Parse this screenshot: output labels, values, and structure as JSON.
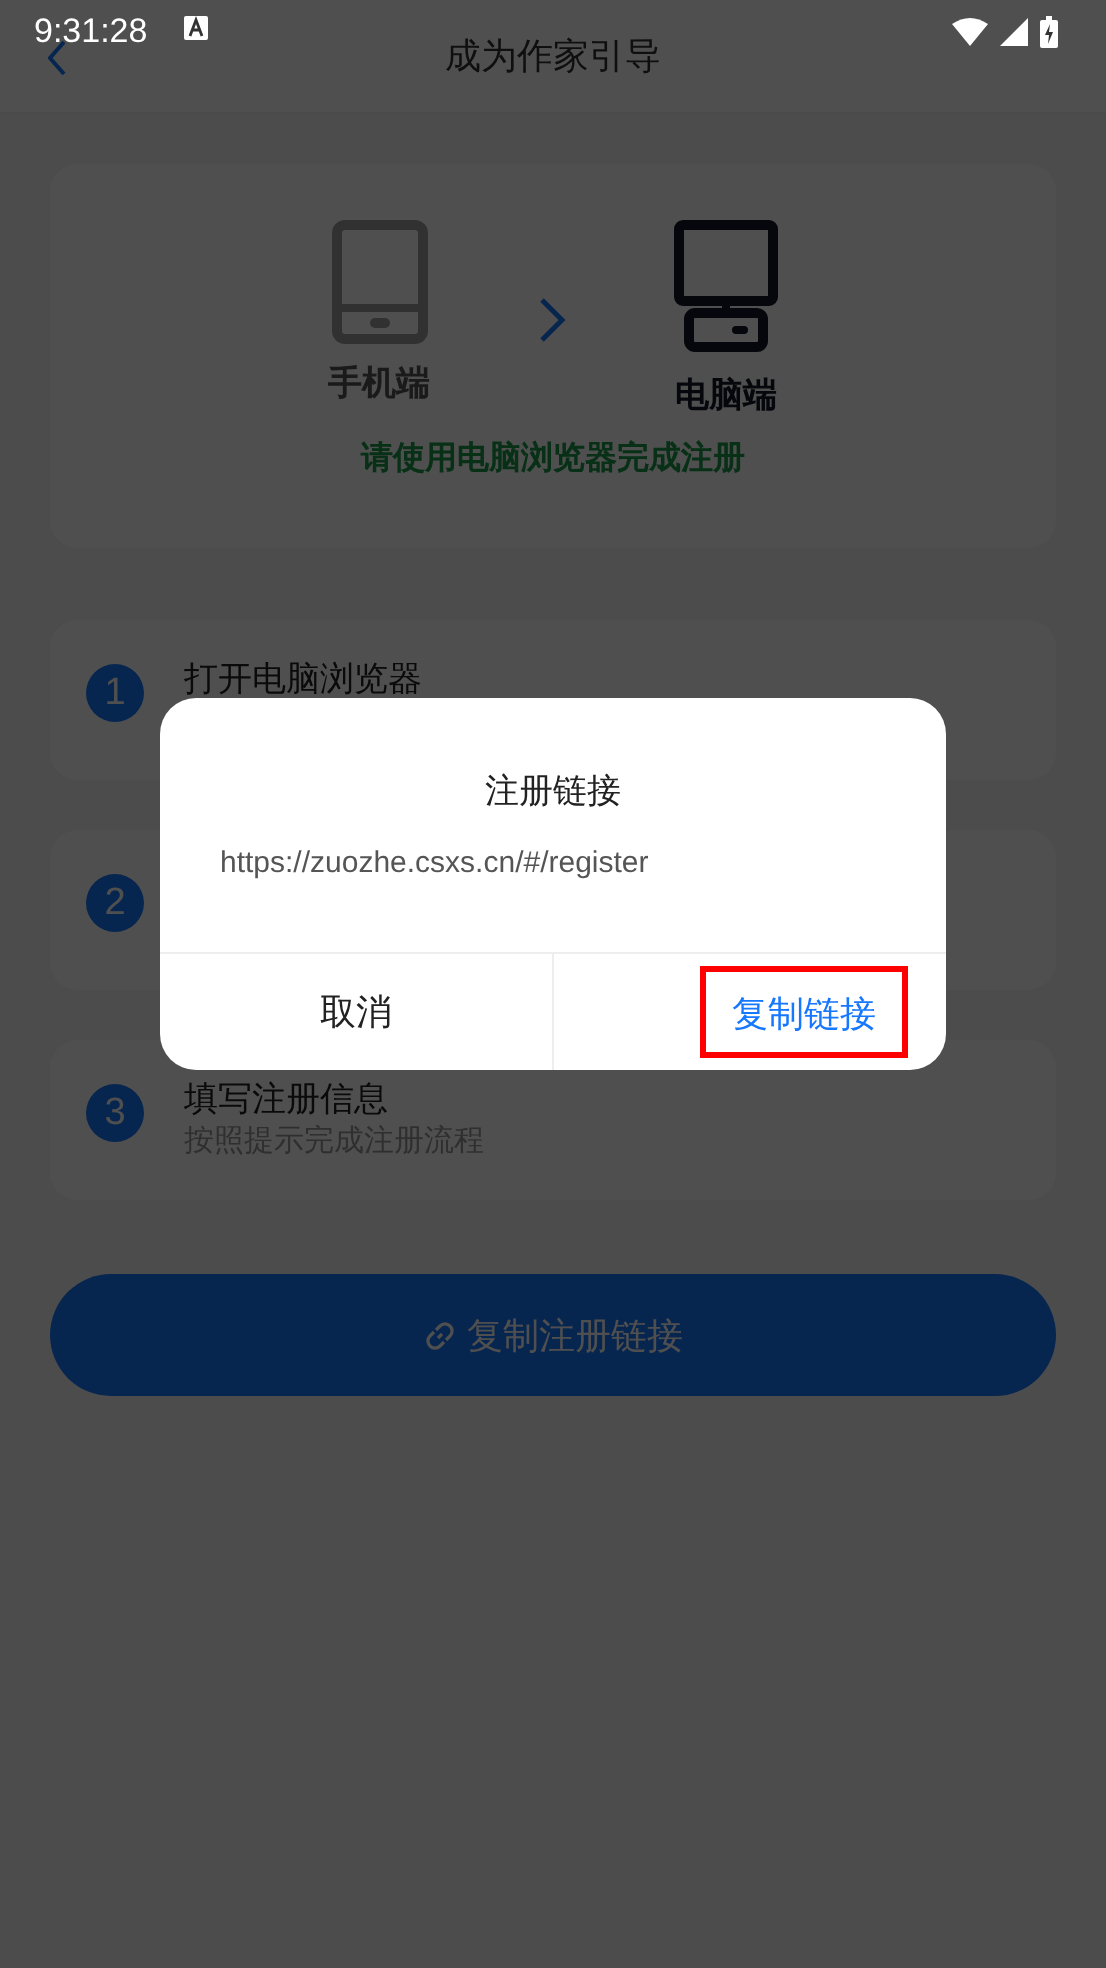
{
  "status_bar": {
    "time": "9:31:28"
  },
  "header": {
    "title": "成为作家引导"
  },
  "devices": {
    "from_label": "手机端",
    "to_label": "电脑端",
    "notice": "请使用电脑浏览器完成注册"
  },
  "steps": [
    {
      "number": "1",
      "title": "打开电脑浏览器"
    },
    {
      "number": "2"
    },
    {
      "number": "3",
      "title": "填写注册信息",
      "subtitle": "按照提示完成注册流程"
    }
  ],
  "primary_button": {
    "label": "复制注册链接"
  },
  "dialog": {
    "title": "注册链接",
    "url": "https://zuozhe.csxs.cn/#/register",
    "buttons": [
      {
        "label": "取消",
        "kind": "cancel",
        "highlighted": false
      },
      {
        "label": "复制链接",
        "kind": "confirm",
        "highlighted": true
      }
    ]
  }
}
